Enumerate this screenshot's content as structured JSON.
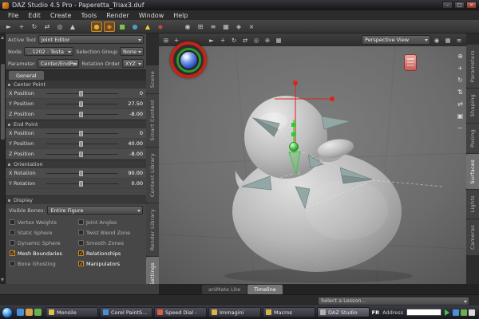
{
  "window": {
    "title": "DAZ Studio 4.5 Pro - Paperetta_Triax3.duf",
    "min_glyph": "–",
    "max_glyph": "□",
    "close_glyph": "×"
  },
  "menu": {
    "items": [
      "File",
      "Edit",
      "Create",
      "Tools",
      "Render",
      "Window",
      "Help"
    ]
  },
  "toolbar": {
    "icons": [
      {
        "glyph": "►"
      },
      {
        "glyph": "+"
      },
      {
        "glyph": "↻"
      },
      {
        "glyph": "⇄"
      },
      {
        "glyph": "◎"
      },
      {
        "glyph": "▲"
      },
      {
        "glyph": "●",
        "color": "#e0b23a",
        "active": true
      },
      {
        "glyph": "◆",
        "color": "#e0813a",
        "active": true
      },
      {
        "glyph": "■",
        "color": "#7ec44a"
      },
      {
        "glyph": "●",
        "color": "#4a9ec4"
      },
      {
        "glyph": "▲",
        "color": "#ded43a"
      },
      {
        "glyph": "◆",
        "color": "#c44a4a"
      },
      {
        "glyph": "◉"
      },
      {
        "glyph": "⊞"
      },
      {
        "glyph": "≡"
      },
      {
        "glyph": "▦"
      },
      {
        "glyph": "◈"
      },
      {
        "glyph": "×"
      }
    ]
  },
  "tool_settings": {
    "active_tool_label": "Active Tool",
    "active_tool": "Joint Editor",
    "node_label": "Node",
    "node_value": "...1202 - Testa",
    "selection_group_label": "Selection Group",
    "selection_group_value": "None",
    "parameter_label": "Parameter",
    "parameter_value": "Center/EndPoi",
    "rotation_order_label": "Rotation Order",
    "rotation_order_value": "XYZ",
    "tab": "General",
    "sections": [
      {
        "title": "Center Point",
        "params": [
          {
            "label": "X Position",
            "value": "0"
          },
          {
            "label": "Y Position",
            "value": "27.50"
          },
          {
            "label": "Z Position",
            "value": "-8.00"
          }
        ]
      },
      {
        "title": "End Point",
        "params": [
          {
            "label": "X Position",
            "value": "0"
          },
          {
            "label": "Y Position",
            "value": "40.00"
          },
          {
            "label": "Z Position",
            "value": "-8.00"
          }
        ]
      },
      {
        "title": "Orientation",
        "params": [
          {
            "label": "X Rotation",
            "value": "90.00"
          },
          {
            "label": "Y Rotation",
            "value": "0.00"
          }
        ]
      }
    ],
    "display": {
      "title": "Display",
      "visible_bones_label": "Visible Bones:",
      "visible_bones_value": "Entire Figure",
      "checkboxes": [
        {
          "label": "Vertex Weights",
          "checked": false
        },
        {
          "label": "Joint Angles",
          "checked": false
        },
        {
          "label": "Static Sphere",
          "checked": false
        },
        {
          "label": "Twist Blend Zone",
          "checked": false
        },
        {
          "label": "Dynamic Sphere",
          "checked": false
        },
        {
          "label": "Smooth Zones",
          "checked": false
        },
        {
          "label": "Mesh Boundaries",
          "checked": true
        },
        {
          "label": "Relationships",
          "checked": true
        },
        {
          "label": "Bone Ghosting",
          "checked": false
        },
        {
          "label": "Manipulators",
          "checked": true
        }
      ]
    }
  },
  "left_tabs": [
    {
      "label": "Scene"
    },
    {
      "label": "Smart Content"
    },
    {
      "label": "Content Library"
    },
    {
      "label": "Render Library"
    },
    {
      "label": "Tool Settings",
      "active": true
    }
  ],
  "right_tabs": [
    {
      "label": "Parameters"
    },
    {
      "label": "Shaping"
    },
    {
      "label": "Posing"
    },
    {
      "label": "Surfaces",
      "active": true
    },
    {
      "label": "Lights"
    },
    {
      "label": "Cameras"
    }
  ],
  "viewport": {
    "corner_icons": [
      {
        "glyph": "⊞"
      },
      {
        "glyph": "+"
      }
    ],
    "tools": [
      {
        "glyph": "►"
      },
      {
        "glyph": "+"
      },
      {
        "glyph": "↻"
      },
      {
        "glyph": "⇄"
      },
      {
        "glyph": "◎"
      },
      {
        "glyph": "⊕"
      },
      {
        "glyph": "▦"
      }
    ],
    "view_selector": "Perspective View",
    "right_icons": [
      {
        "glyph": "◉"
      },
      {
        "glyph": "▦"
      },
      {
        "glyph": "≡"
      }
    ],
    "nav_icons": [
      {
        "glyph": "⊕"
      },
      {
        "glyph": "+"
      },
      {
        "glyph": "↻"
      },
      {
        "glyph": "⇅"
      },
      {
        "glyph": "⇄"
      },
      {
        "glyph": "▣"
      },
      {
        "glyph": "−"
      }
    ]
  },
  "bottom": {
    "tabs": [
      {
        "label": "aniMate Lite"
      },
      {
        "label": "Timeline",
        "active": true
      }
    ],
    "lesson": "Select a Lesson..."
  },
  "taskbar": {
    "quick_launch": [
      {
        "color": "#4a90d9"
      },
      {
        "color": "#d9a34a"
      },
      {
        "color": "#6ab04c"
      }
    ],
    "items": [
      {
        "label": "Mensile",
        "color": "#d9c34a"
      },
      {
        "label": "Corel PaintS...",
        "color": "#4a90d9"
      },
      {
        "label": "Speed Dial -",
        "color": "#d95f4a"
      },
      {
        "label": "Immagini",
        "color": "#d9b34a"
      },
      {
        "label": "Macros",
        "color": "#d9b34a"
      },
      {
        "label": "DAZ Studio",
        "color": "#b0b0b0",
        "active": true
      }
    ],
    "language": "FR",
    "address_label": "Address",
    "tray": [
      {
        "color": "#4a90d9"
      },
      {
        "color": "#6ab04c"
      },
      {
        "color": "#d9d9d9"
      }
    ]
  }
}
